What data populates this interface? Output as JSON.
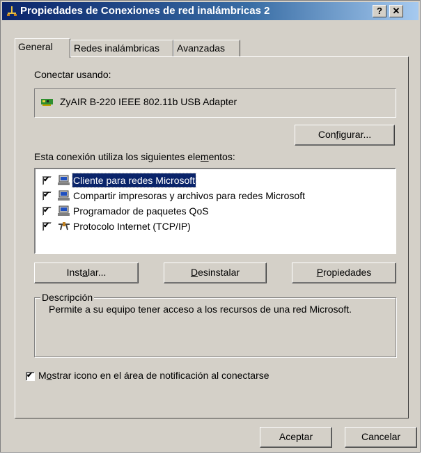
{
  "window": {
    "title": "Propiedades de Conexiones de red inalámbricas 2",
    "help_button": "?",
    "close_button": "✕"
  },
  "tabs": [
    {
      "label": "General",
      "active": true
    },
    {
      "label": "Redes inalámbricas",
      "active": false
    },
    {
      "label": "Avanzadas",
      "active": false
    }
  ],
  "general": {
    "connect_using_label": "Conectar usando:",
    "adapter_name": "ZyAIR B-220 IEEE 802.11b USB Adapter",
    "configure_button": {
      "pre": "Con",
      "accel": "f",
      "post": "igurar..."
    },
    "elements_label": {
      "pre": "Esta conexión utiliza los siguientes ele",
      "accel": "m",
      "post": "entos:"
    },
    "components": [
      {
        "label": "Cliente para redes Microsoft",
        "checked": true,
        "selected": true,
        "icon": "network-client-icon"
      },
      {
        "label": "Compartir impresoras y archivos para redes Microsoft",
        "checked": true,
        "selected": false,
        "icon": "file-printer-sharing-icon"
      },
      {
        "label": "Programador de paquetes QoS",
        "checked": true,
        "selected": false,
        "icon": "qos-scheduler-icon"
      },
      {
        "label": "Protocolo Internet (TCP/IP)",
        "checked": true,
        "selected": false,
        "icon": "protocol-icon"
      }
    ],
    "install_button": {
      "pre": "Inst",
      "accel": "a",
      "post": "lar..."
    },
    "uninstall_button": {
      "pre": "",
      "accel": "D",
      "post": "esinstalar"
    },
    "properties_button": {
      "pre": "",
      "accel": "P",
      "post": "ropiedades"
    },
    "description_legend": "Descripción",
    "description_text": "Permite a su equipo tener acceso a los recursos de una red Microsoft.",
    "show_icon_checkbox": {
      "pre": "M",
      "accel": "o",
      "post": "strar icono en el área de notificación al conectarse",
      "checked": true
    }
  },
  "footer": {
    "ok_button": "Aceptar",
    "cancel_button": "Cancelar"
  },
  "colors": {
    "face": "#d4d0c8",
    "title_start": "#0a246a",
    "title_end": "#a6caf0",
    "selection": "#0a246a"
  }
}
